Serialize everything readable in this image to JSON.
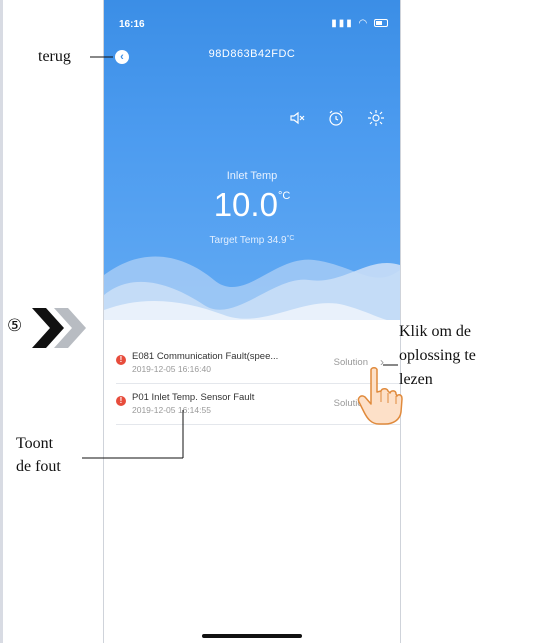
{
  "status_bar": {
    "time": "16:16"
  },
  "header": {
    "back_symbol": "‹",
    "device_id": "98D863B42FDC",
    "icons": [
      "mute-speaker-icon",
      "alarm-clock-icon",
      "brightness-icon"
    ]
  },
  "temperature": {
    "inlet_label": "Inlet Temp",
    "inlet_value": "10.0",
    "inlet_unit": "°C",
    "target_label": "Target Temp",
    "target_value": "34.9",
    "target_unit": "°C"
  },
  "faults": [
    {
      "title": "E081 Communication Fault(spee...",
      "time": "2019-12-05 16:16:40",
      "action": "Solution"
    },
    {
      "title": "P01 Inlet Temp. Sensor Fault",
      "time": "2019-12-05 16:14:55",
      "action": "Solution"
    }
  ],
  "annotations": {
    "back": "terug",
    "step": "⑤",
    "solution_note_1": "Klik om de",
    "solution_note_2": "oplossing te",
    "solution_note_3": "lezen",
    "fault_note_1": "Toont",
    "fault_note_2": "de fout"
  },
  "colors": {
    "header_blue": "#3b8ee6",
    "error_red": "#e74c3c"
  }
}
